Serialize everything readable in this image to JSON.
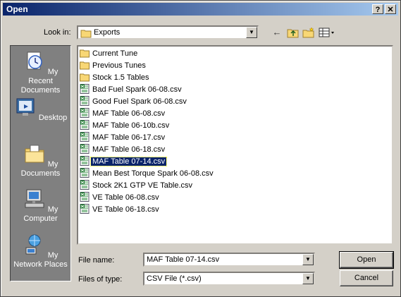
{
  "window": {
    "title": "Open",
    "help_button": "?",
    "close_button": "✕"
  },
  "lookin": {
    "label": "Look in:",
    "value": "Exports"
  },
  "places": [
    {
      "label": "My Recent Documents",
      "icon": "recent-documents-icon"
    },
    {
      "label": "Desktop",
      "icon": "desktop-icon"
    },
    {
      "label": "My Documents",
      "icon": "my-documents-icon"
    },
    {
      "label": "My Computer",
      "icon": "my-computer-icon"
    },
    {
      "label": "My Network Places",
      "icon": "network-places-icon"
    }
  ],
  "files": [
    {
      "name": "Current Tune",
      "type": "folder"
    },
    {
      "name": "Previous Tunes",
      "type": "folder"
    },
    {
      "name": "Stock 1.5 Tables",
      "type": "folder"
    },
    {
      "name": "Bad Fuel Spark 06-08.csv",
      "type": "csv"
    },
    {
      "name": "Good Fuel Spark 06-08.csv",
      "type": "csv"
    },
    {
      "name": "MAF Table 06-08.csv",
      "type": "csv"
    },
    {
      "name": "MAF Table 06-10b.csv",
      "type": "csv"
    },
    {
      "name": "MAF Table 06-17.csv",
      "type": "csv"
    },
    {
      "name": "MAF Table 06-18.csv",
      "type": "csv"
    },
    {
      "name": "MAF Table 07-14.csv",
      "type": "csv",
      "selected": true
    },
    {
      "name": "Mean Best Torque Spark 06-08.csv",
      "type": "csv"
    },
    {
      "name": "Stock 2K1 GTP VE Table.csv",
      "type": "csv"
    },
    {
      "name": "VE Table 06-08.csv",
      "type": "csv"
    },
    {
      "name": "VE Table 06-18.csv",
      "type": "csv"
    }
  ],
  "filename": {
    "label": "File name:",
    "value": "MAF Table 07-14.csv"
  },
  "filetype": {
    "label": "Files of type:",
    "value": "CSV File (*.csv)"
  },
  "buttons": {
    "open": "Open",
    "cancel": "Cancel"
  }
}
